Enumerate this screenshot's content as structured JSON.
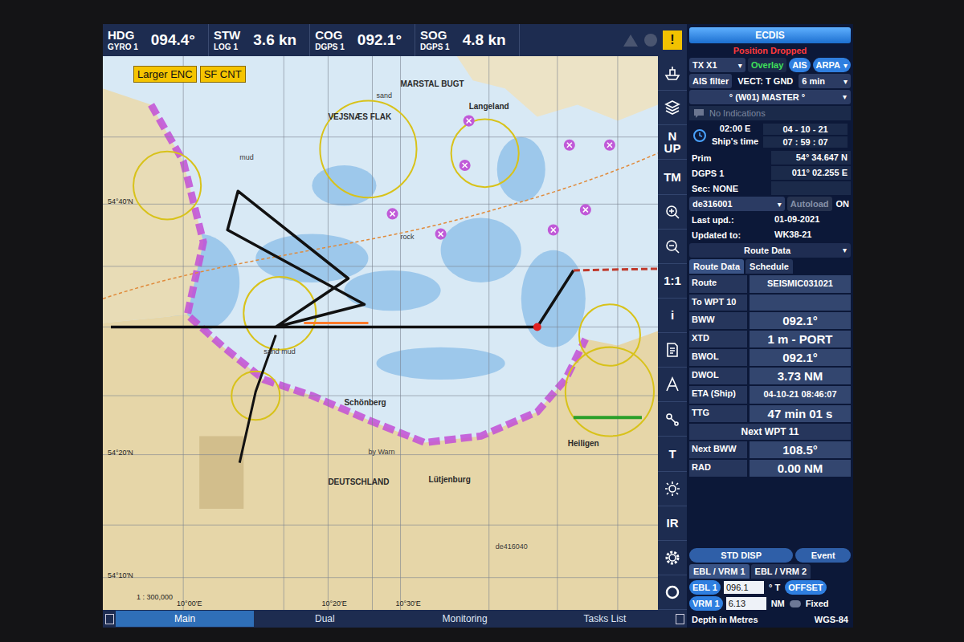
{
  "nav": [
    {
      "label": "HDG",
      "source": "GYRO 1",
      "value": "094.4°"
    },
    {
      "label": "STW",
      "source": "LOG 1",
      "value": "3.6 kn"
    },
    {
      "label": "COG",
      "source": "DGPS 1",
      "value": "092.1°"
    },
    {
      "label": "SOG",
      "source": "DGPS 1",
      "value": "4.8 kn"
    }
  ],
  "alarm": {
    "mark": "!",
    "active": true
  },
  "chart_badges": [
    "Larger ENC",
    "SF CNT"
  ],
  "map": {
    "labels": [
      {
        "text": "DEUTSCHLAND",
        "kind": "place"
      },
      {
        "text": "MARSTAL BUGT",
        "kind": "place"
      },
      {
        "text": "VEJSNÆS FLAK",
        "kind": "place"
      },
      {
        "text": "Langeland",
        "kind": "place"
      },
      {
        "text": "Schönberg",
        "kind": "place"
      },
      {
        "text": "Lütjenburg",
        "kind": "place"
      },
      {
        "text": "Heiligen",
        "kind": "place"
      },
      {
        "text": "de416040",
        "kind": "note"
      },
      {
        "text": "sand",
        "kind": "note"
      },
      {
        "text": "mud",
        "kind": "note"
      },
      {
        "text": "rock",
        "kind": "note"
      },
      {
        "text": "sand mud",
        "kind": "note"
      },
      {
        "text": "by Warn",
        "kind": "note"
      },
      {
        "text": "1 : 300,000",
        "kind": "grid"
      },
      {
        "text": "54°40'N",
        "kind": "grid"
      },
      {
        "text": "54°20'N",
        "kind": "grid"
      },
      {
        "text": "54°10'N",
        "kind": "grid"
      },
      {
        "text": "10°00'E",
        "kind": "grid"
      },
      {
        "text": "10°20'E",
        "kind": "grid"
      },
      {
        "text": "10°30'E",
        "kind": "grid"
      }
    ]
  },
  "toolbar": [
    {
      "kind": "icon"
    },
    {
      "kind": "icon"
    },
    {
      "kind": "text",
      "lines": [
        "N",
        "UP"
      ]
    },
    {
      "kind": "text",
      "lines": [
        "TM"
      ]
    },
    {
      "kind": "icon"
    },
    {
      "kind": "icon"
    },
    {
      "kind": "text",
      "lines": [
        "1:1"
      ]
    },
    {
      "kind": "text",
      "lines": [
        "i"
      ]
    },
    {
      "kind": "icon"
    },
    {
      "kind": "icon"
    },
    {
      "kind": "icon"
    },
    {
      "kind": "text",
      "lines": [
        "T"
      ]
    },
    {
      "kind": "icon"
    },
    {
      "kind": "text",
      "lines": [
        "IR"
      ]
    },
    {
      "kind": "icon"
    },
    {
      "kind": "icon"
    }
  ],
  "bottom_tabs": [
    {
      "label": "Main",
      "selected": true
    },
    {
      "label": "Dual",
      "selected": false
    },
    {
      "label": "Monitoring",
      "selected": false
    },
    {
      "label": "Tasks List",
      "selected": false
    }
  ],
  "panel": {
    "title": "ECDIS",
    "status": "Position Dropped",
    "caret": "▾",
    "row1": [
      {
        "label": "TX X1",
        "kind": "dropdown",
        "on": false
      },
      {
        "label": "Overlay",
        "kind": "toggle",
        "on": true
      },
      {
        "label": "AIS",
        "kind": "pill",
        "on": true
      },
      {
        "label": "ARPA",
        "kind": "pill-dropdown",
        "on": true
      }
    ],
    "row2": [
      {
        "label": "AIS filter",
        "kind": "button"
      },
      {
        "label": "VECT: T GND",
        "kind": "label"
      },
      {
        "label": "6 min",
        "kind": "dropdown"
      }
    ],
    "mode": "° (W01) MASTER °",
    "indications": {
      "text": "No Indications",
      "disabled": true
    },
    "time": {
      "zone": "02:00 E",
      "date": "04 - 10 - 21",
      "label": "Ship's time",
      "clock": "07 : 59 : 07"
    },
    "position": [
      {
        "label": "Prim",
        "value": "54° 34.647 N"
      },
      {
        "label": "DGPS 1",
        "value": "011° 02.255 E"
      }
    ],
    "secondary": "Sec: NONE",
    "cell": {
      "name": "de316001",
      "autoload": "Autoload",
      "autoload_disabled": true,
      "state": "ON"
    },
    "updates": [
      {
        "label": "Last upd.:",
        "value": "01-09-2021"
      },
      {
        "label": "Updated to:",
        "value": "WK38-21"
      }
    ],
    "data_select": "Route Data",
    "data_tabs": [
      {
        "label": "Route Data",
        "selected": true
      },
      {
        "label": "Schedule",
        "selected": false
      }
    ],
    "route_rows": [
      {
        "label": "Route",
        "value": "SEISMIC031021"
      },
      {
        "label": "To WPT 10",
        "value": ""
      },
      {
        "label": "BWW",
        "value": "092.1°"
      },
      {
        "label": "XTD",
        "value": "1 m - PORT"
      },
      {
        "label": "BWOL",
        "value": "092.1°"
      },
      {
        "label": "DWOL",
        "value": "3.73 NM"
      },
      {
        "label": "ETA (Ship)",
        "value": "04-10-21 08:46:07"
      },
      {
        "label": "TTG",
        "value": "47 min 01 s"
      }
    ],
    "next_wpt": {
      "title": "Next WPT 11",
      "rows": [
        {
          "label": "Next BWW",
          "value": "108.5°"
        },
        {
          "label": "RAD",
          "value": "0.00 NM"
        }
      ]
    },
    "actions": [
      "STD DISP",
      "Event"
    ],
    "ebl_tabs": [
      {
        "label": "EBL / VRM 1",
        "selected": true
      },
      {
        "label": "EBL / VRM 2",
        "selected": false
      }
    ],
    "ebl": {
      "label": "EBL 1",
      "value": "096.1",
      "unit": "° T",
      "button": "OFFSET"
    },
    "vrm": {
      "label": "VRM 1",
      "value": "6.13",
      "unit": "NM",
      "check": "Fixed",
      "checked": false
    },
    "footer": [
      "Depth in Metres",
      "WGS-84"
    ]
  }
}
